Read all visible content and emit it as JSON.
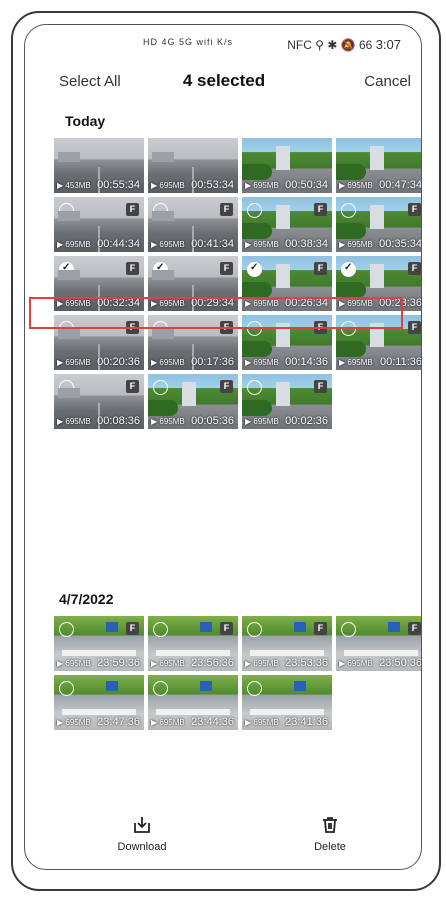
{
  "status": {
    "left_icons": "HD 4G 5G wifi K/s",
    "right_icons": "NFC ⚲ ✱ 🔕 66",
    "time": "3:07"
  },
  "topbar": {
    "select_all": "Select All",
    "title": "4 selected",
    "cancel": "Cancel"
  },
  "sections": [
    {
      "label": "Today"
    },
    {
      "label": "4/7/2022"
    }
  ],
  "today_tiles": [
    {
      "scene": "road",
      "size": "453MB",
      "duration": "00:55:34",
      "checkbox": false,
      "f": false
    },
    {
      "scene": "road",
      "size": "695MB",
      "duration": "00:53:34",
      "checkbox": false,
      "f": false
    },
    {
      "scene": "tree",
      "size": "695MB",
      "duration": "00:50:34",
      "checkbox": false,
      "f": false
    },
    {
      "scene": "tree",
      "size": "695MB",
      "duration": "00:47:34",
      "checkbox": false,
      "f": false
    },
    {
      "scene": "road",
      "size": "695MB",
      "duration": "00:44:34",
      "checkbox": true,
      "checked": false,
      "f": true
    },
    {
      "scene": "road",
      "size": "695MB",
      "duration": "00:41:34",
      "checkbox": true,
      "checked": false,
      "f": true
    },
    {
      "scene": "tree",
      "size": "695MB",
      "duration": "00:38:34",
      "checkbox": true,
      "checked": false,
      "f": true
    },
    {
      "scene": "tree",
      "size": "695MB",
      "duration": "00:35:34",
      "checkbox": true,
      "checked": false,
      "f": true
    },
    {
      "scene": "road",
      "size": "695MB",
      "duration": "00:32:34",
      "checkbox": true,
      "checked": true,
      "f": true
    },
    {
      "scene": "road",
      "size": "695MB",
      "duration": "00:29:34",
      "checkbox": true,
      "checked": true,
      "f": true
    },
    {
      "scene": "tree",
      "size": "695MB",
      "duration": "00:26:34",
      "checkbox": true,
      "checked": true,
      "f": true
    },
    {
      "scene": "tree",
      "size": "695MB",
      "duration": "00:23:36",
      "checkbox": true,
      "checked": true,
      "f": true
    },
    {
      "scene": "road",
      "size": "695MB",
      "duration": "00:20:36",
      "checkbox": true,
      "checked": false,
      "f": true
    },
    {
      "scene": "road",
      "size": "695MB",
      "duration": "00:17:36",
      "checkbox": true,
      "checked": false,
      "f": true
    },
    {
      "scene": "tree",
      "size": "695MB",
      "duration": "00:14:36",
      "checkbox": true,
      "checked": false,
      "f": true
    },
    {
      "scene": "tree",
      "size": "695MB",
      "duration": "00:11:36",
      "checkbox": true,
      "checked": false,
      "f": true
    },
    {
      "scene": "road",
      "size": "695MB",
      "duration": "00:08:36",
      "checkbox": true,
      "checked": false,
      "f": true
    },
    {
      "scene": "tree",
      "size": "695MB",
      "duration": "00:05:36",
      "checkbox": true,
      "checked": false,
      "f": true
    },
    {
      "scene": "tree",
      "size": "695MB",
      "duration": "00:02:36",
      "checkbox": true,
      "checked": false,
      "f": true
    }
  ],
  "date_tiles": [
    {
      "scene": "street",
      "size": "695MB",
      "duration": "23:59:36",
      "checkbox": true,
      "checked": false,
      "f": true
    },
    {
      "scene": "street",
      "size": "695MB",
      "duration": "23:56:36",
      "checkbox": true,
      "checked": false,
      "f": true
    },
    {
      "scene": "street",
      "size": "695MB",
      "duration": "23:53:36",
      "checkbox": true,
      "checked": false,
      "f": true
    },
    {
      "scene": "street",
      "size": "695MB",
      "duration": "23:50:36",
      "checkbox": true,
      "checked": false,
      "f": true
    },
    {
      "scene": "street",
      "size": "695MB",
      "duration": "23:47:36",
      "checkbox": true,
      "checked": false,
      "f": false
    },
    {
      "scene": "street",
      "size": "695MB",
      "duration": "23:44:36",
      "checkbox": true,
      "checked": false,
      "f": false
    },
    {
      "scene": "street",
      "size": "695MB",
      "duration": "23:41:36",
      "checkbox": true,
      "checked": false,
      "f": false
    }
  ],
  "f_badge": "F",
  "bottom": {
    "download": "Download",
    "delete": "Delete"
  },
  "colors": {
    "selection_outline": "#e0413e"
  }
}
